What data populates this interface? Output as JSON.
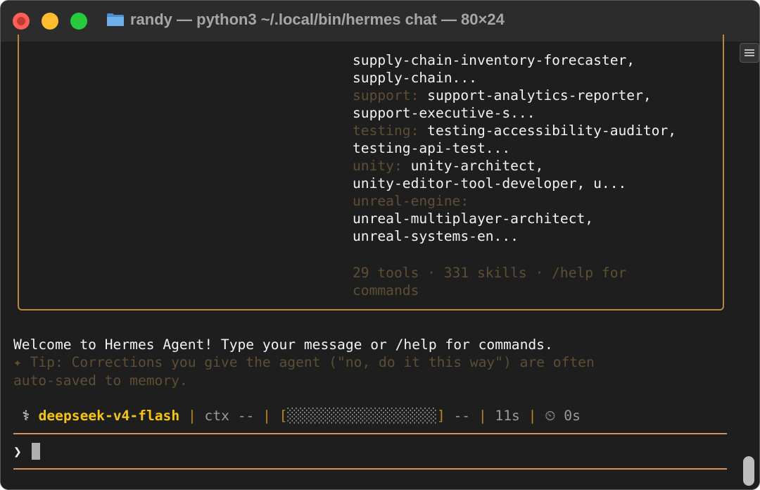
{
  "window": {
    "title": "randy — python3 ~/.local/bin/hermes chat — 80×24"
  },
  "skills_panel": [
    {
      "category": "",
      "text": "supply-chain-inventory-forecaster,"
    },
    {
      "category": "",
      "text": "supply-chain..."
    },
    {
      "category": "support:",
      "text": " support-analytics-reporter,"
    },
    {
      "category": "",
      "text": "support-executive-s..."
    },
    {
      "category": "testing:",
      "text": " testing-accessibility-auditor,"
    },
    {
      "category": "",
      "text": "testing-api-test..."
    },
    {
      "category": "unity:",
      "text": " unity-architect,"
    },
    {
      "category": "",
      "text": "unity-editor-tool-developer, u..."
    },
    {
      "category": "unreal-engine:",
      "text": ""
    },
    {
      "category": "",
      "text": "unreal-multiplayer-architect,"
    },
    {
      "category": "",
      "text": "unreal-systems-en..."
    }
  ],
  "summary": {
    "line1": "29 tools · 331 skills · /help for",
    "line2": "commands"
  },
  "welcome": "Welcome to Hermes Agent! Type your message or /help for commands.",
  "tip": {
    "line1": "✦ Tip: Corrections you give the agent (\"no, do it this way\") are often",
    "line2": "auto-saved to memory."
  },
  "status_bar": {
    "icon": "⚕",
    "model": "deepseek-v4-flash",
    "sep": "|",
    "ctx": "ctx --",
    "bar_open": "[",
    "bar_fill": "░░░░░░░░░░░░░░░░░░",
    "bar_close": "]",
    "bar_value": "--",
    "elapsed": "11s",
    "timer_icon": "⏲",
    "timer": "0s"
  },
  "prompt": {
    "symbol": "❯",
    "value": ""
  },
  "colors": {
    "background": "#1e1e1e",
    "accent": "#f5c414",
    "border": "#b8863c",
    "rule": "#d6925a",
    "dim_text": "#5e4e34"
  }
}
